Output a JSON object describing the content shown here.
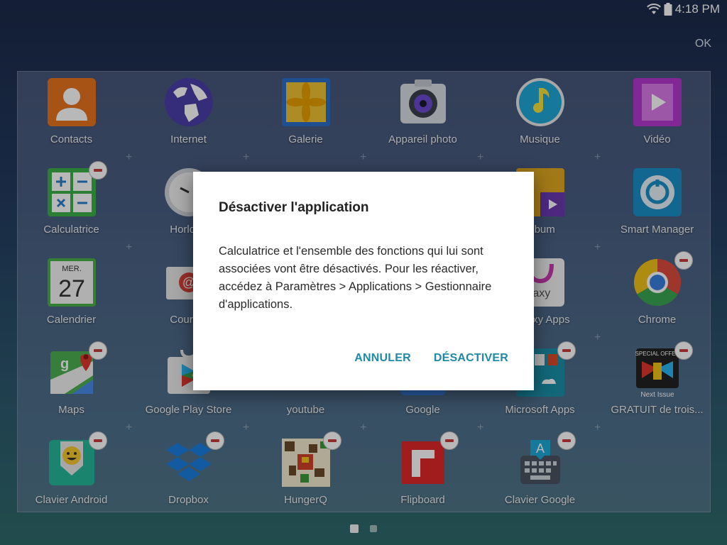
{
  "status": {
    "time": "4:18 PM"
  },
  "top_action": {
    "ok_label": "OK"
  },
  "apps": [
    {
      "label": "Contacts"
    },
    {
      "label": "Internet"
    },
    {
      "label": "Galerie"
    },
    {
      "label": "Appareil photo"
    },
    {
      "label": "Musique"
    },
    {
      "label": "Vidéo"
    },
    {
      "label": "Calculatrice"
    },
    {
      "label": "Horloge"
    },
    {
      "label": ""
    },
    {
      "label": ""
    },
    {
      "label": "Album"
    },
    {
      "label": "Smart Manager"
    },
    {
      "label": "Calendrier",
      "date_day": "MER.",
      "date_num": "27"
    },
    {
      "label": "Courriel"
    },
    {
      "label": ""
    },
    {
      "label": ""
    },
    {
      "label": "Galaxy Apps",
      "icon_text": "laxy"
    },
    {
      "label": "Chrome"
    },
    {
      "label": "Maps"
    },
    {
      "label": "Google Play Store"
    },
    {
      "label": "youtube"
    },
    {
      "label": "Google"
    },
    {
      "label": "Microsoft Apps"
    },
    {
      "label": "GRATUIT de trois...",
      "badge_top": "SPECIAL OFFER",
      "badge_bottom": "Next Issue"
    },
    {
      "label": "Clavier Android"
    },
    {
      "label": "Dropbox"
    },
    {
      "label": "HungerQ"
    },
    {
      "label": "Flipboard"
    },
    {
      "label": "Clavier Google",
      "icon_text": "A"
    }
  ],
  "dialog": {
    "title": "Désactiver l'application",
    "body": "Calculatrice et l'ensemble des fonctions qui lui sont associées vont être désactivés. Pour les réactiver, accédez à Paramètres > Applications > Gestionnaire d'applications.",
    "cancel": "ANNULER",
    "confirm": "DÉSACTIVER"
  },
  "colors": {
    "accent": "#1e8aa6",
    "minus_badge": "#c83c3c"
  },
  "pager": {
    "pages": 2,
    "current": 1
  }
}
